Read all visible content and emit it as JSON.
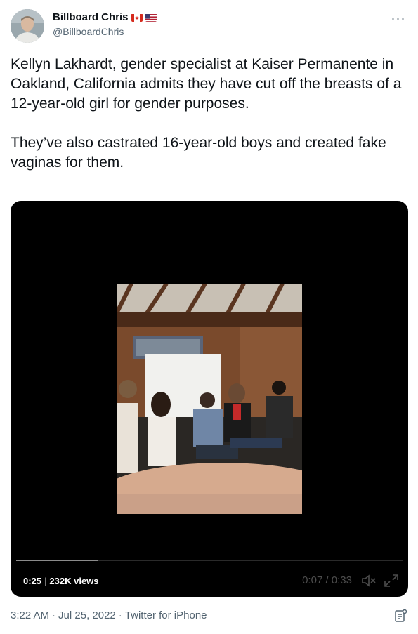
{
  "author": {
    "name": "Billboard Chris",
    "handle": "@BillboardChris",
    "flags": [
      "canada-flag-icon",
      "usa-flag-icon"
    ]
  },
  "tweet": {
    "paragraphs": [
      "Kellyn Lakhardt, gender specialist at Kaiser Permanente in Oakland, California admits they have cut off the breasts of a 12-year-old girl for gender purposes.",
      "They’ve also castrated 16-year-old boys and created fake vaginas for them."
    ]
  },
  "video": {
    "duration": "0:25",
    "views": "232K views",
    "time_display": "0:07 / 0:33",
    "progress": 0.21,
    "icons": [
      "mute-icon",
      "fullscreen-icon"
    ]
  },
  "footer": {
    "time": "3:22 AM",
    "date": "Jul 25, 2022",
    "source": "Twitter for iPhone"
  },
  "colors": {
    "text": "#0f1419",
    "secondary": "#536471",
    "video_bg": "#000000"
  }
}
